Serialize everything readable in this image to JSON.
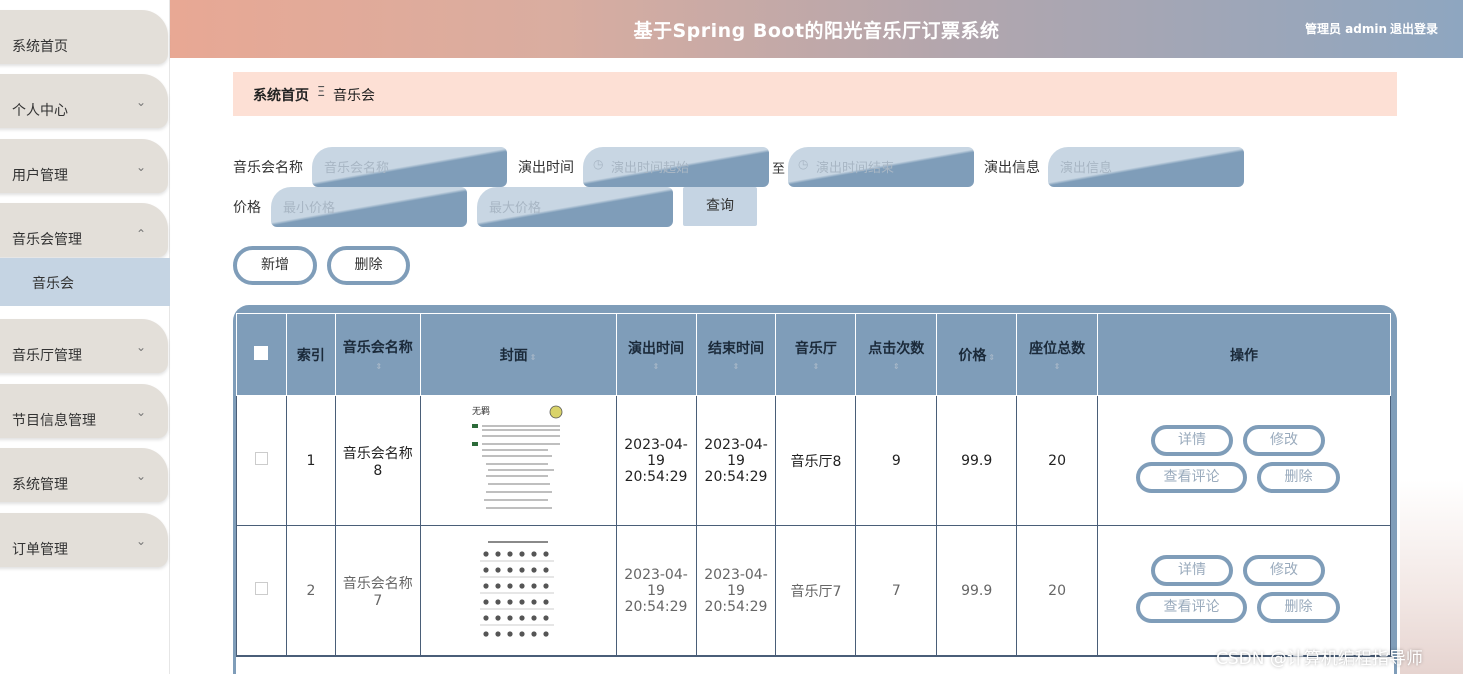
{
  "header": {
    "title": "基于Spring Boot的阳光音乐厅订票系统",
    "user": "管理员 admin",
    "logout": "退出登录"
  },
  "sidebar": {
    "items": [
      {
        "label": "系统首页",
        "has_children": false
      },
      {
        "label": "个人中心",
        "has_children": true
      },
      {
        "label": "用户管理",
        "has_children": true
      },
      {
        "label": "音乐会管理",
        "has_children": true,
        "expanded": true
      },
      {
        "label": "音乐厅管理",
        "has_children": true
      },
      {
        "label": "节目信息管理",
        "has_children": true
      },
      {
        "label": "系统管理",
        "has_children": true
      },
      {
        "label": "订单管理",
        "has_children": true
      }
    ],
    "subitem": "音乐会",
    "chevron_down": "⌄",
    "chevron_up": "⌃"
  },
  "breadcrumb": {
    "home": "系统首页",
    "separator": "Ξ",
    "current": "音乐会"
  },
  "search": {
    "name_label": "音乐会名称",
    "name_placeholder": "音乐会名称",
    "time_label": "演出时间",
    "time_start_placeholder": "演出时间起始",
    "time_to": "至",
    "time_end_placeholder": "演出时间结束",
    "info_label": "演出信息",
    "info_placeholder": "演出信息",
    "price_label": "价格",
    "min_price_placeholder": "最小价格",
    "max_price_placeholder": "最大价格",
    "query_button": "查询"
  },
  "actions": {
    "add": "新增",
    "delete": "删除"
  },
  "table": {
    "headers": {
      "index": "索引",
      "name": "音乐会名称",
      "cover": "封面",
      "start": "演出时间",
      "end": "结束时间",
      "hall": "音乐厅",
      "clicks": "点击次数",
      "price": "价格",
      "seats": "座位总数",
      "ops": "操作"
    },
    "rows": [
      {
        "index": "1",
        "name": "音乐会名称8",
        "start": "2023-04-19 20:54:29",
        "end": "2023-04-19 20:54:29",
        "hall": "音乐厅8",
        "clicks": "9",
        "price": "99.9",
        "seats": "20"
      },
      {
        "index": "2",
        "name": "音乐会名称7",
        "start": "2023-04-19 20:54:29",
        "end": "2023-04-19 20:54:29",
        "hall": "音乐厅7",
        "clicks": "7",
        "price": "99.9",
        "seats": "20"
      }
    ],
    "row_buttons": {
      "detail": "详情",
      "edit": "修改",
      "comments": "查看评论",
      "delete": "删除"
    },
    "cover1_title": "无羁",
    "sort_glyph": "⇕"
  },
  "watermark": "CSDN @计算机编程指导师",
  "colors": {
    "accent": "#7f9db9",
    "accent_light": "#c5d4e3",
    "breadcrumb_bg": "#fde0d5",
    "sidebar_item": "#e3dfd9"
  }
}
